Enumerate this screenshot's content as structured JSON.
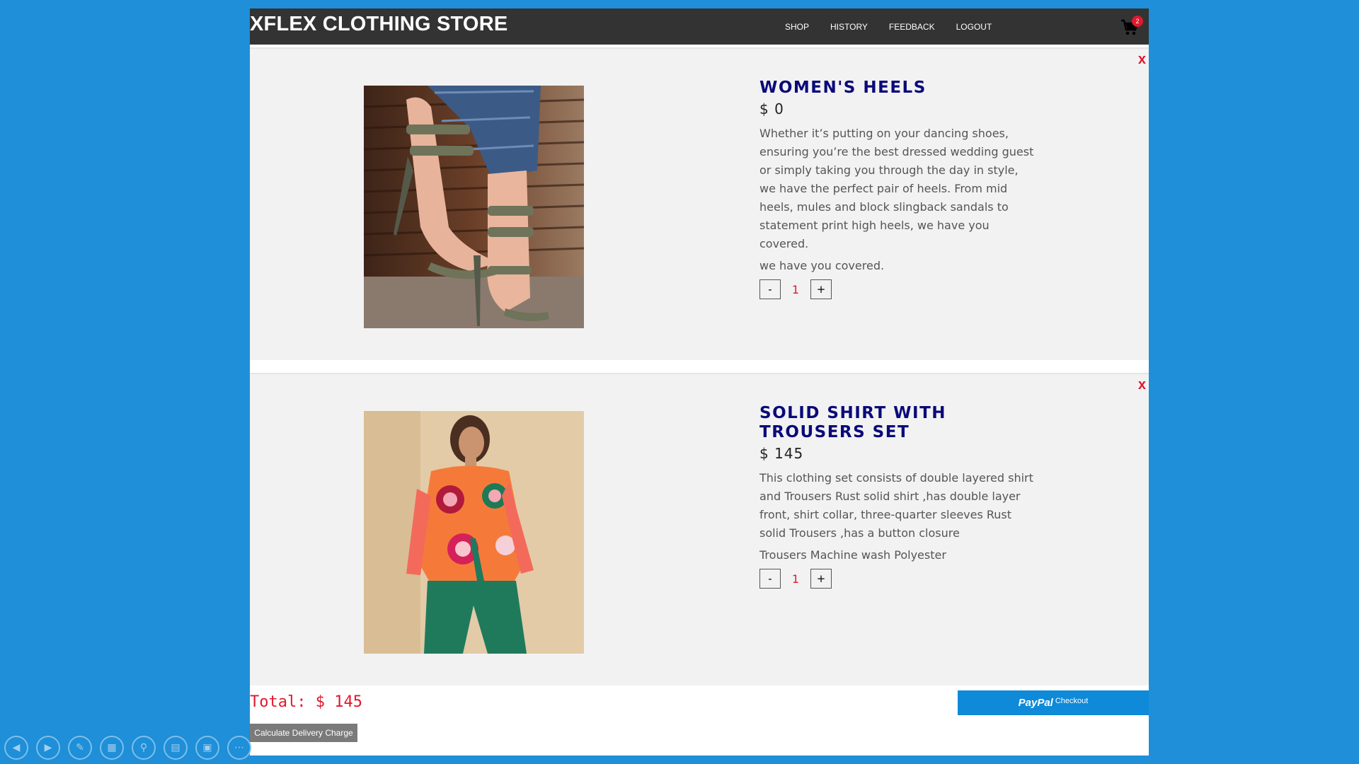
{
  "header": {
    "brand": "XFLEX CLOTHING STORE",
    "nav": [
      "SHOP",
      "HISTORY",
      "FEEDBACK",
      "LOGOUT"
    ],
    "cart_count": "2"
  },
  "items": [
    {
      "title": "WOMEN'S HEELS",
      "price": "$ 0",
      "description": "Whether it’s putting on your dancing shoes, ensuring you’re the best dressed wedding guest or simply taking you through the day in style, we have the perfect pair of heels. From mid heels, mules and block slingback sandals to statement print high heels, we have you covered.",
      "description2": "we have you covered.",
      "quantity": "1",
      "remove_label": "x",
      "minus_label": "-",
      "plus_label": "+"
    },
    {
      "title": "SOLID SHIRT WITH TROUSERS SET",
      "price": "$ 145",
      "description": "This clothing set consists of double layered shirt and Trousers Rust solid shirt ,has double layer front, shirt collar, three-quarter sleeves Rust solid Trousers ,has a button closure",
      "description2": "Trousers Machine wash Polyester",
      "quantity": "1",
      "remove_label": "x",
      "minus_label": "-",
      "plus_label": "+"
    }
  ],
  "footer": {
    "total": "Total: $ 145",
    "delivery_button": "Calculate Delivery Charge",
    "paypal_brand": "PayPal",
    "paypal_label": "Checkout"
  },
  "colors": {
    "background": "#1e8fd8",
    "topbar": "#333333",
    "accent_red": "#e0182d",
    "title_navy": "#0a0a7a",
    "paypal_blue": "#0e8ad9"
  },
  "toolbar_icons": [
    "previous-icon",
    "next-icon",
    "pen-icon",
    "slides-icon",
    "zoom-icon",
    "subtitles-icon",
    "screen-icon",
    "more-icon"
  ]
}
